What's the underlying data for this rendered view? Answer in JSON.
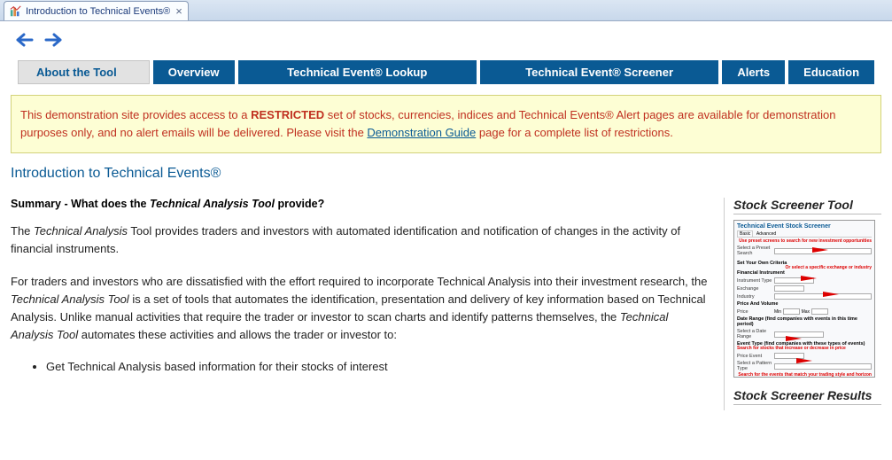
{
  "docTab": {
    "title": "Introduction to Technical Events®"
  },
  "mainTabs": {
    "about": "About the Tool",
    "overview": "Overview",
    "lookup": "Technical Event® Lookup",
    "screener": "Technical Event® Screener",
    "alerts": "Alerts",
    "education": "Education"
  },
  "notice": {
    "pre": "This demonstration site provides access to a ",
    "bold": "RESTRICTED",
    "post": " set of stocks, currencies, indices and Technical Events® Alert pages are available for demonstration purposes only, and no alert emails will be delivered. Please visit the ",
    "link": "Demonstration Guide",
    "end": " page for a complete list of restrictions."
  },
  "pageTitle": "Introduction to Technical Events®",
  "summaryHeading": {
    "pre": "Summary - What does the ",
    "em": "Technical Analysis Tool",
    "post": " provide?"
  },
  "para1": {
    "pre": "The ",
    "em": "Technical Analysis",
    "post": " Tool provides traders and investors with automated identification and notification of changes in the activity of financial instruments."
  },
  "para2": {
    "pre": "For traders and investors who are dissatisfied with the effort required to incorporate Technical Analysis into their investment research, the ",
    "em1": "Technical Analysis Tool",
    "mid": " is a set of tools that automates the identification, presentation and delivery of key information based on Technical Analysis. Unlike manual activities that require the trader or investor to scan charts and identify patterns themselves, the ",
    "em2": "Technical Analysis Tool",
    "post": " automates these activities and allows the trader or investor to:"
  },
  "bullet1": "Get Technical Analysis based information for their stocks of interest",
  "side": {
    "screenerTitle": "Stock Screener Tool",
    "resultsTitle": "Stock Screener Results",
    "thumbHeader": "Technical Event Stock Screener",
    "annot1": "Use preset screens to search for new investment opportunities",
    "annot2": "Or select a specific exchange or industry",
    "annot3": "Search for stocks that increase or decrease in price",
    "annot4": "Search for the events that match your trading style and horizon"
  }
}
